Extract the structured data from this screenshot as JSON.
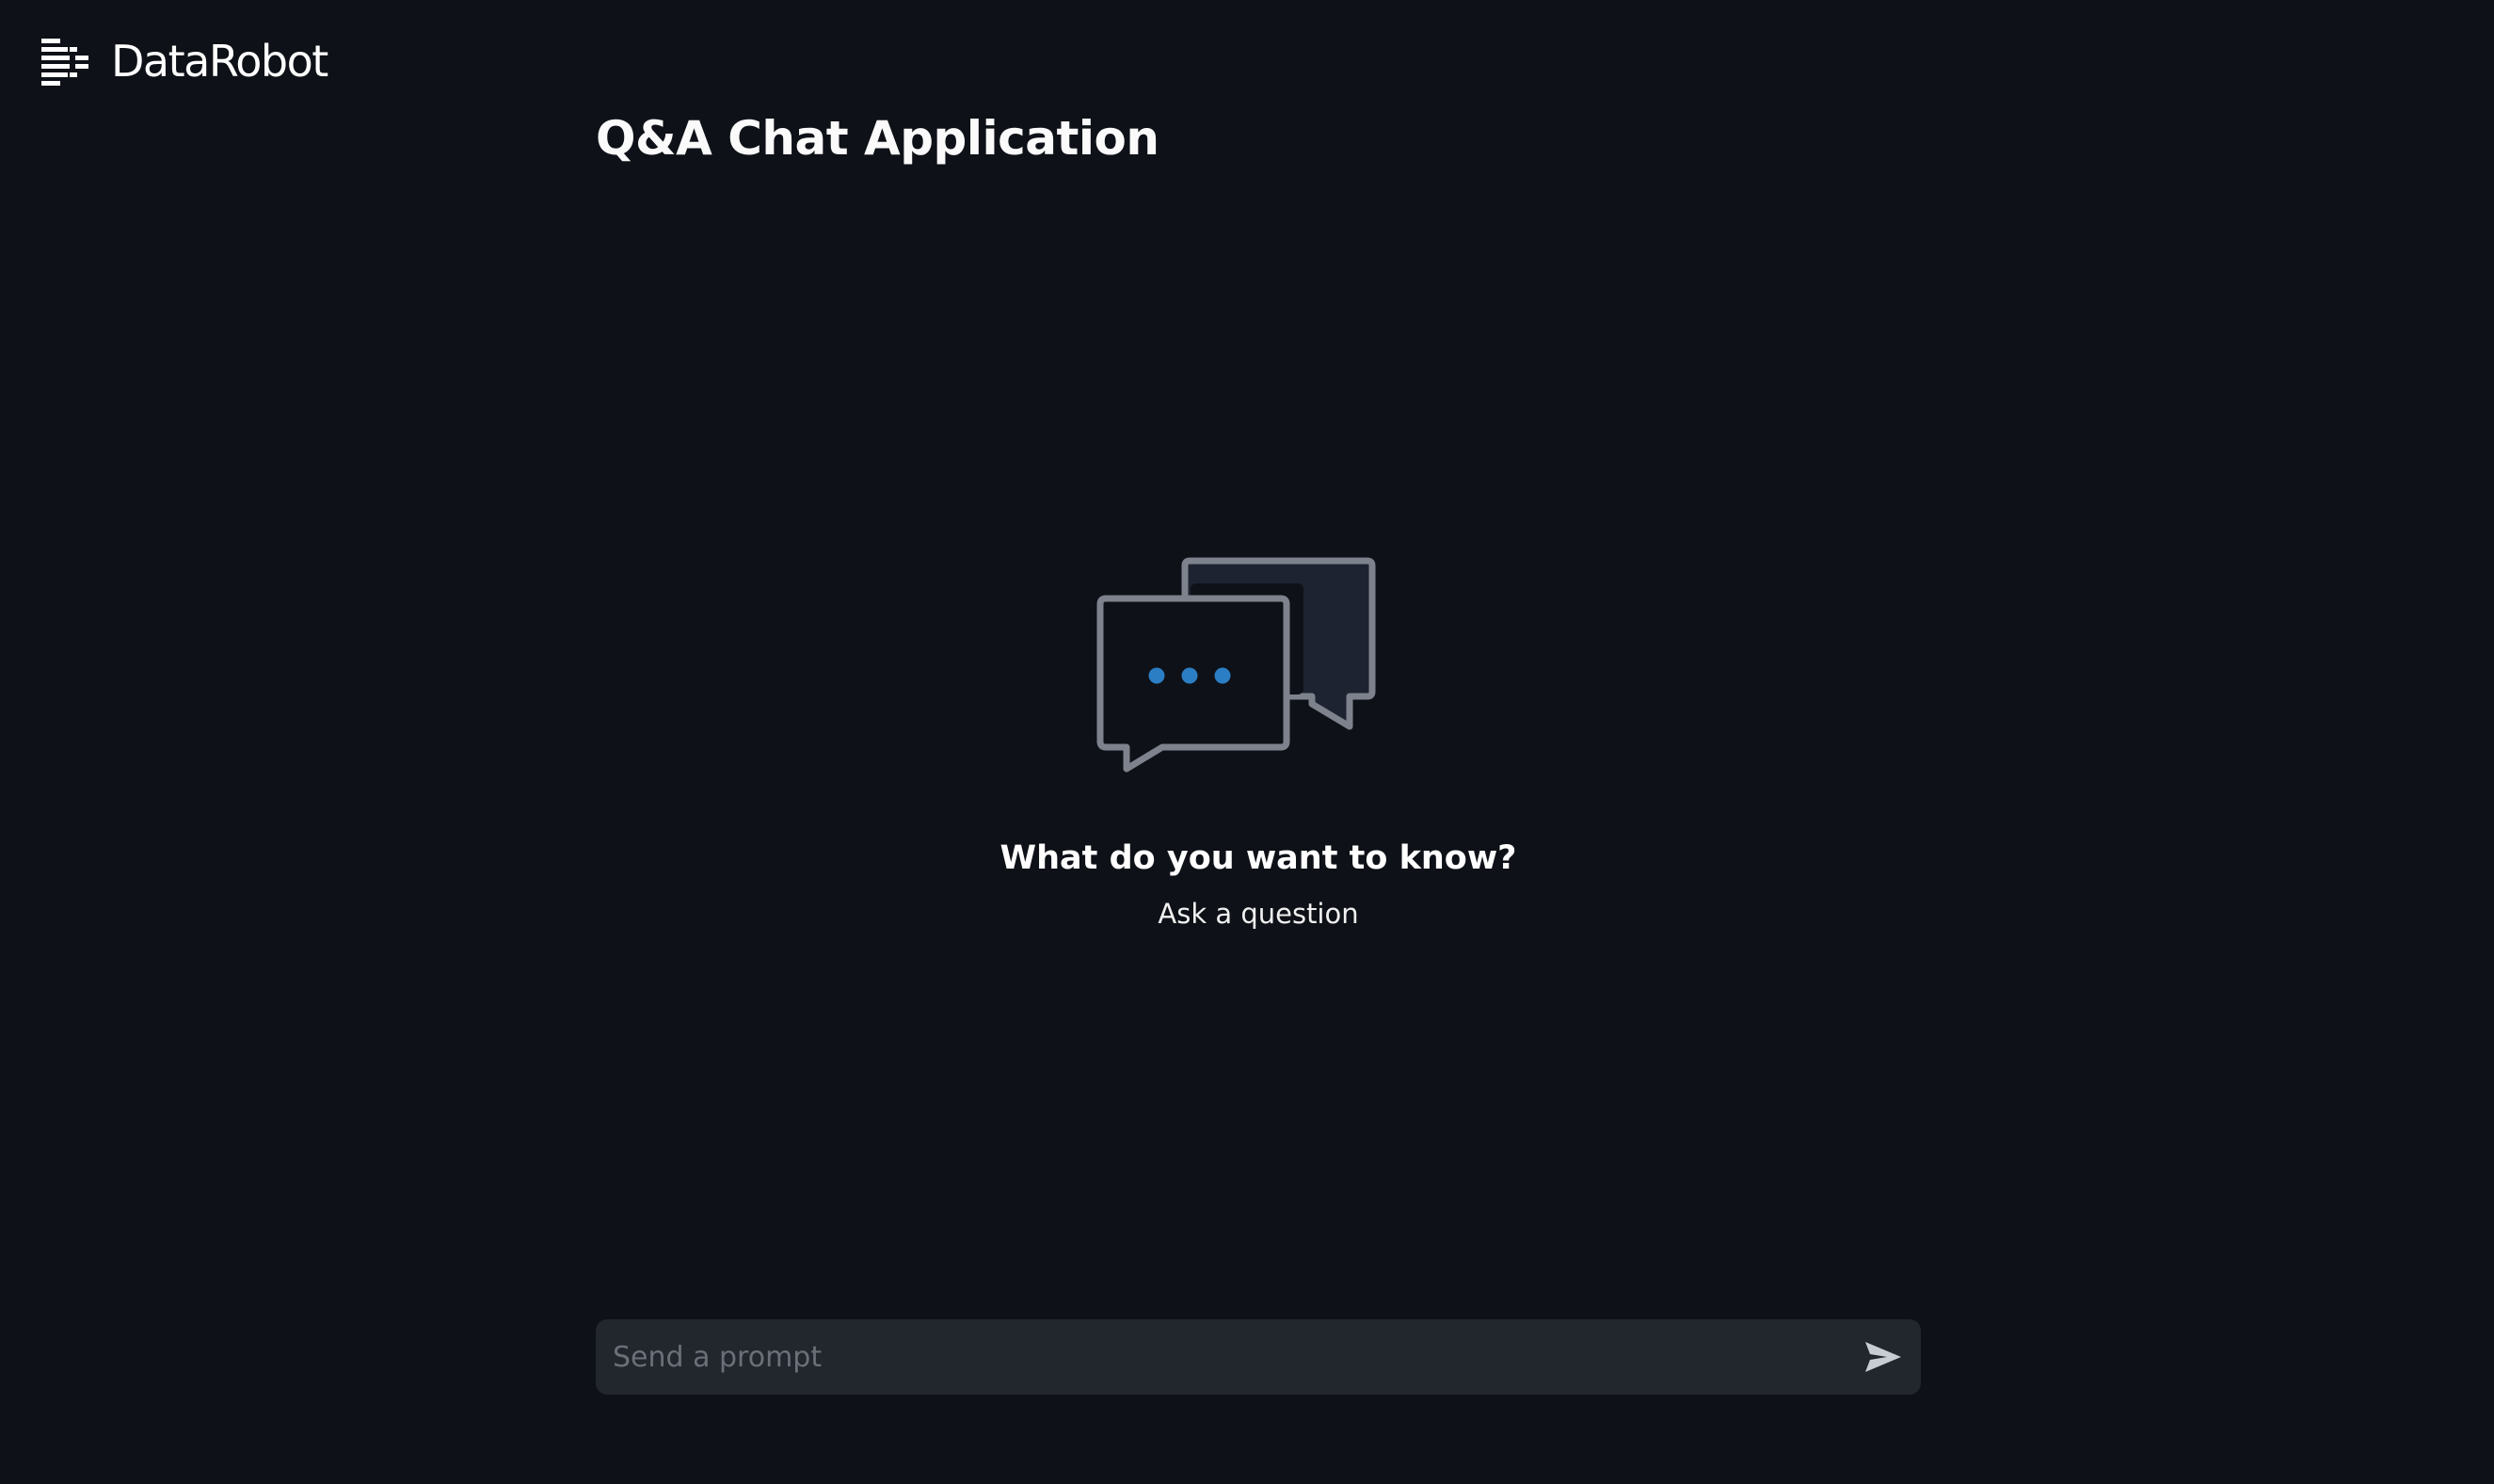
{
  "brand": {
    "name": "DataRobot",
    "icon": "datarobot-logo-icon"
  },
  "header": {
    "title": "Q&A Chat Application"
  },
  "empty_state": {
    "icon": "chat-bubbles-icon",
    "heading": "What do you want to know?",
    "subheading": "Ask a question"
  },
  "prompt": {
    "placeholder": "Send a prompt",
    "value": "",
    "send_icon": "send-icon"
  },
  "colors": {
    "background": "#0e1117",
    "input_background": "#22262d",
    "accent_dots": "#2b7ec4",
    "bubble_stroke": "#7d828c",
    "text": "#ffffff"
  }
}
